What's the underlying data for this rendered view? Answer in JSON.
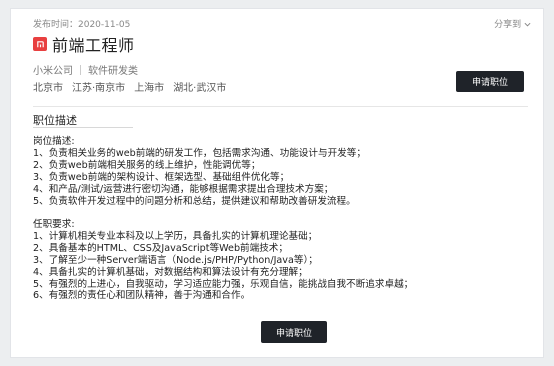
{
  "header": {
    "publish_time": "发布时间：2020-11-05",
    "share": "分享到",
    "title": "前端工程师",
    "company": "小米公司",
    "category": "软件研发类",
    "cities": [
      "北京市",
      "江苏·南京市",
      "上海市",
      "湖北·武汉市"
    ],
    "apply_label": "申请职位"
  },
  "description": {
    "section_title": "职位描述",
    "duties_heading": "岗位描述:",
    "duties": [
      "1、负责相关业务的web前端的研发工作，包括需求沟通、功能设计与开发等；",
      "2、负责web前端相关服务的线上维护，性能调优等；",
      "3、负责web前端的架构设计、框架选型、基础组件优化等；",
      "4、和产品/测试/运营进行密切沟通，能够根据需求提出合理技术方案；",
      "5、负责软件开发过程中的问题分析和总结，提供建议和帮助改善研发流程。"
    ],
    "requirements_heading": "任职要求:",
    "requirements": [
      "1、计算机相关专业本科及以上学历，具备扎实的计算机理论基础；",
      "2、具备基本的HTML、CSS及JavaScript等Web前端技术；",
      "3、了解至少一种Server端语言（Node.js/PHP/Python/Java等）；",
      "4、具备扎实的计算机基础，对数据结构和算法设计有充分理解；",
      "5、有强烈的上进心，自我驱动，学习适应能力强，乐观自信，能挑战自我不断追求卓越；",
      "6、有强烈的责任心和团队精神，善于沟通和合作。"
    ]
  },
  "footer": {
    "apply_label": "申请职位"
  },
  "colors": {
    "logo": "#e84040",
    "button": "#1f2329"
  },
  "icons": {
    "logo": "company-logo-icon",
    "share": "chevron-down-icon"
  }
}
